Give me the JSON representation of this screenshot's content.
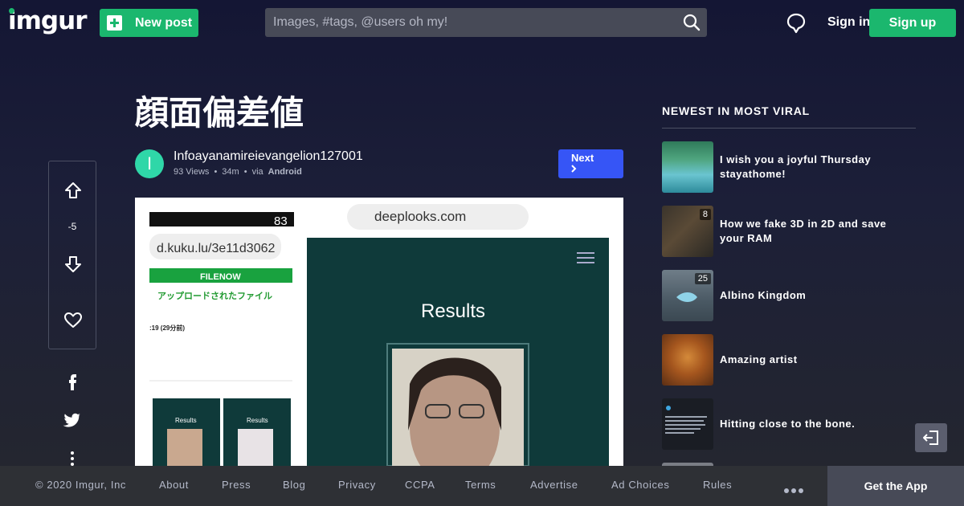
{
  "header": {
    "logo": "imgur",
    "new_post_label": "New post",
    "search_placeholder": "Images, #tags, @users oh my!",
    "sign_in_label": "Sign in",
    "sign_up_label": "Sign up",
    "icons": {
      "new_post": "plus-square-icon",
      "search": "search-icon",
      "chat": "chat-bubble-icon"
    }
  },
  "post": {
    "title": "顔面偏差値",
    "author": "Infoayanamireievangelion127001",
    "avatar_letter": "I",
    "views": "93 Views",
    "age": "34m",
    "via_prefix": "via",
    "via_source": "Android",
    "next_label": "Next",
    "next_icon": "chevron-right-icon",
    "score": "-5",
    "accent_color": "#1bb76e"
  },
  "screenshot": {
    "status_time_partial": "83",
    "url_short": "d.kuku.lu/3e11d3062",
    "filenow": "FILENOW",
    "uploaded_text": "アップロードされたファイル",
    "time_ago": ":19 (29分前)",
    "site": "deeplooks.com",
    "results_label": "Results",
    "mini_results_1": "Results",
    "mini_results_2": "Results"
  },
  "sidebar": {
    "title": "NEWEST IN MOST VIRAL",
    "items": [
      {
        "title": "I wish you a joyful Thursday stayathome!",
        "count": ""
      },
      {
        "title": "How we fake 3D in 2D and save your RAM",
        "count": "8"
      },
      {
        "title": "Albino Kingdom",
        "count": "25"
      },
      {
        "title": "Amazing artist",
        "count": ""
      },
      {
        "title": "Hitting close to the bone.",
        "count": ""
      }
    ]
  },
  "footer": {
    "copyright": "© 2020 Imgur, Inc",
    "links": [
      "About",
      "Press",
      "Blog",
      "Privacy",
      "CCPA",
      "Terms",
      "Advertise",
      "Ad Choices",
      "Rules"
    ],
    "get_app_label": "Get the App"
  }
}
